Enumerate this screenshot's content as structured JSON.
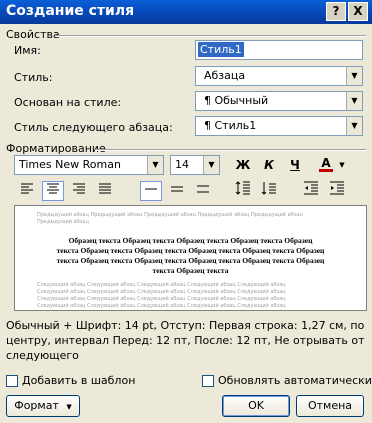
{
  "window": {
    "title": "Создание стиля",
    "help_label": "?",
    "close_label": "X"
  },
  "properties": {
    "section_label": "Свойства",
    "name_label": "Имя:",
    "name_value": "Стиль1",
    "style_label": "Стиль:",
    "style_value": "Абзаца",
    "based_on_label": "Основан на стиле:",
    "based_on_value": "¶ Обычный",
    "next_style_label": "Стиль следующего абзаца:",
    "next_style_value": "¶ Стиль1"
  },
  "formatting": {
    "section_label": "Форматирование",
    "font_value": "Times New Roman",
    "size_value": "14",
    "bold_label": "Ж",
    "italic_label": "К",
    "underline_label": "Ч",
    "font_color_label": "A",
    "colors": {
      "font_color": "#c00000",
      "title_bar": "#0846b4",
      "selection": "#316ac5"
    }
  },
  "preview": {
    "prev_paragraph": [
      "Предыдущий абзац Предыдущий абзац Предыдущий абзац Предыдущий абзац Предыдущий абзац",
      "Предыдущий абзац"
    ],
    "sample_lines": [
      "Образец текста Образец текста Образец текста Образец текста Образец",
      "текста Образец текста Образец текста Образец текста Образец текста Образец",
      "текста Образец текста Образец текста Образец текста Образец текста Образец",
      "текста Образец текста"
    ],
    "next_paragraph": [
      "Следующий абзац Следующий абзац Следующий абзац Следующий абзац Следующий абзац",
      "Следующий абзац Следующий абзац Следующий абзац Следующий абзац Следующий абзац",
      "Следующий абзац Следующий абзац Следующий абзац Следующий абзац Следующий абзац",
      "Следующий абзац Следующий абзац Следующий абзац Следующий абзац Следующий абзац"
    ]
  },
  "description": "Обычный + Шрифт: 14 pt, Отступ: Первая строка: 1,27 см, по центру, интервал Перед: 12 пт, После: 12 пт, Не отрывать от следующего",
  "options": {
    "add_to_template_label": "Добавить в шаблон",
    "auto_update_label": "Обновлять автоматически"
  },
  "buttons": {
    "format_label": "Формат",
    "ok_label": "OK",
    "cancel_label": "Отмена"
  }
}
